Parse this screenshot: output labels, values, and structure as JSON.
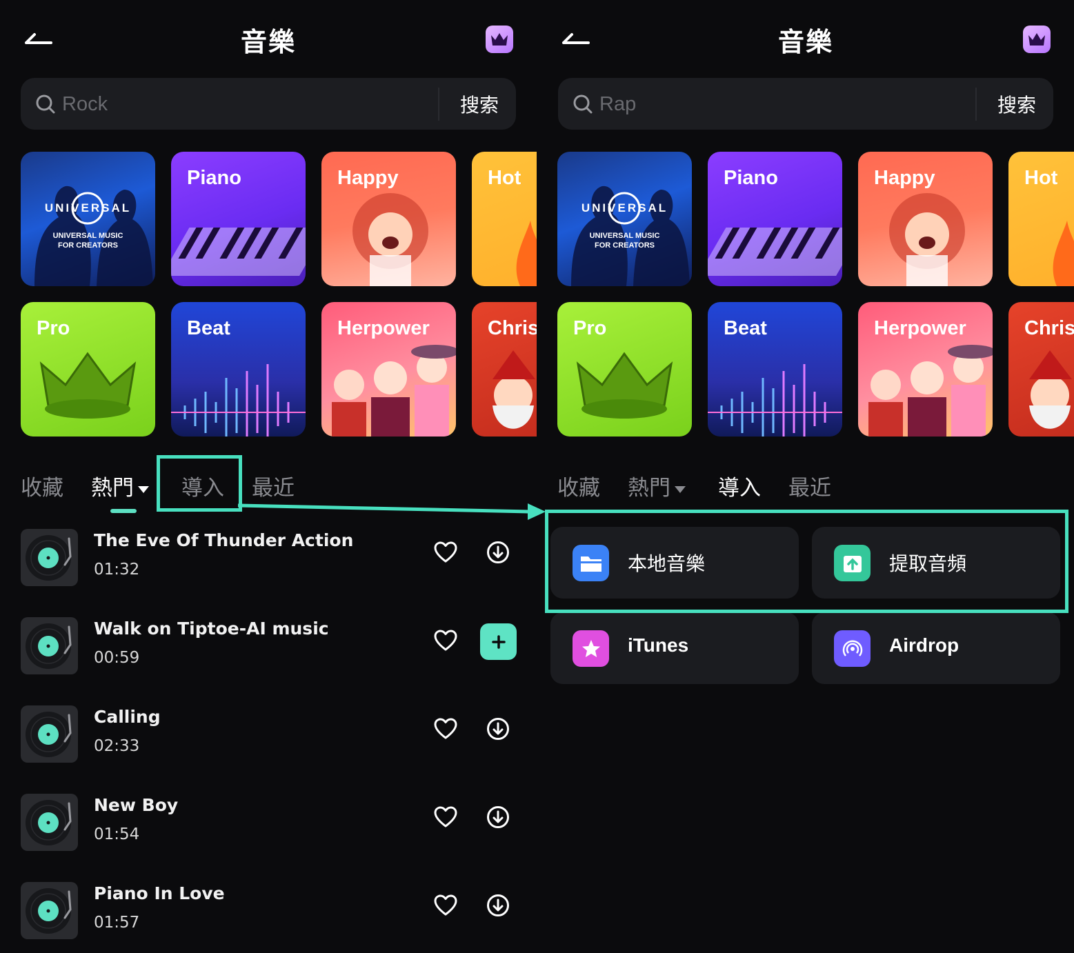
{
  "colors": {
    "background": "#0b0b0d",
    "accent": "#48e0bf",
    "surface": "#1b1c20"
  },
  "left": {
    "title": "音樂",
    "search": {
      "value": "",
      "placeholder": "Rock",
      "button": "搜索"
    },
    "categories": [
      {
        "label": "",
        "lines": [
          "UNIVERSAL",
          "UNIVERSAL MUSIC",
          "FOR CREATORS"
        ]
      },
      {
        "label": "Piano"
      },
      {
        "label": "Happy"
      },
      {
        "label": "Hot"
      },
      {
        "label": "Pro"
      },
      {
        "label": "Beat"
      },
      {
        "label": "Herpower"
      },
      {
        "label": "Chris"
      }
    ],
    "tabs": [
      {
        "label": "收藏"
      },
      {
        "label": "熱門"
      },
      {
        "label": "導入"
      },
      {
        "label": "最近"
      }
    ],
    "active_tab": "熱門",
    "songs": [
      {
        "title": "The Eve Of Thunder Action",
        "duration": "01:32",
        "action": "download"
      },
      {
        "title": "Walk on Tiptoe-AI music",
        "duration": "00:59",
        "action": "add"
      },
      {
        "title": "Calling",
        "duration": "02:33",
        "action": "download"
      },
      {
        "title": "New Boy",
        "duration": "01:54",
        "action": "download"
      },
      {
        "title": "Piano In Love",
        "duration": "01:57",
        "action": "download"
      }
    ]
  },
  "right": {
    "title": "音樂",
    "search": {
      "value": "",
      "placeholder": "Rap",
      "button": "搜索"
    },
    "categories": [
      {
        "label": "",
        "lines": [
          "UNIVERSAL",
          "UNIVERSAL MUSIC",
          "FOR CREATORS"
        ]
      },
      {
        "label": "Piano"
      },
      {
        "label": "Happy"
      },
      {
        "label": "Hot"
      },
      {
        "label": "Pro"
      },
      {
        "label": "Beat"
      },
      {
        "label": "Herpower"
      },
      {
        "label": "Chris"
      }
    ],
    "tabs": [
      {
        "label": "收藏"
      },
      {
        "label": "熱門"
      },
      {
        "label": "導入"
      },
      {
        "label": "最近"
      }
    ],
    "active_tab": "導入",
    "import_options": [
      {
        "label": "本地音樂",
        "icon": "folder-icon",
        "color": "#3b82f6"
      },
      {
        "label": "提取音頻",
        "icon": "upload-file-icon",
        "color": "#34c79a"
      },
      {
        "label": "iTunes",
        "icon": "star-icon",
        "color": "#e04fe0"
      },
      {
        "label": "Airdrop",
        "icon": "airdrop-icon",
        "color": "#6f5cff"
      }
    ]
  }
}
